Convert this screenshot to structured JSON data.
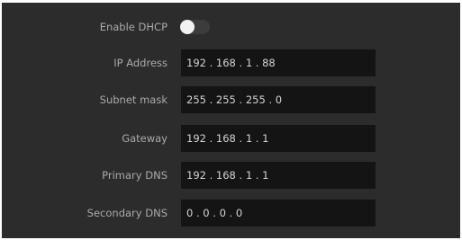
{
  "network": {
    "dhcp": {
      "label": "Enable DHCP",
      "enabled": false
    },
    "fields": [
      {
        "label": "IP Address",
        "value": "192 . 168 . 1 . 88"
      },
      {
        "label": "Subnet mask",
        "value": "255 . 255 . 255 . 0"
      },
      {
        "label": "Gateway",
        "value": "192 . 168 . 1 . 1"
      },
      {
        "label": "Primary DNS",
        "value": "192 . 168 . 1 . 1"
      },
      {
        "label": "Secondary DNS",
        "value": "0 . 0 . 0 . 0"
      }
    ]
  }
}
